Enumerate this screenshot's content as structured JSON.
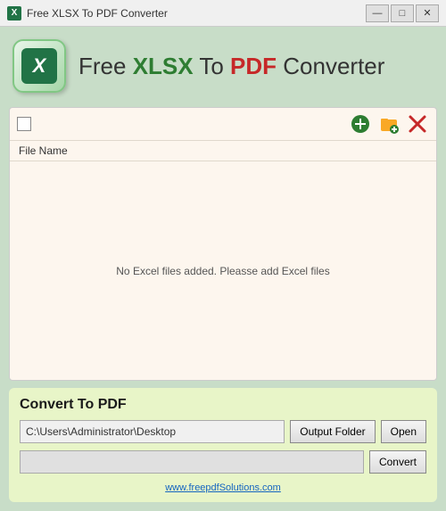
{
  "titleBar": {
    "icon": "X",
    "title": "Free XLSX To PDF Converter",
    "minimize": "—",
    "maximize": "□",
    "close": "✕"
  },
  "header": {
    "iconLetter": "X",
    "titlePart1": "Free ",
    "titlePart2": "XLSX",
    "titlePart3": " To ",
    "titlePart4": "PDF",
    "titlePart5": " Converter"
  },
  "fileArea": {
    "columnHeader": "File Name",
    "emptyMessage": "No Excel files added. Pleasse add Excel files"
  },
  "toolbar": {
    "addGreenTooltip": "Add files",
    "addYellowTooltip": "Add folder",
    "deleteTooltip": "Remove files"
  },
  "bottomSection": {
    "convertTitle": "Convert To PDF",
    "outputPath": "C:\\Users\\Administrator\\Desktop",
    "outputFolderLabel": "Output Folder",
    "openLabel": "Open",
    "convertLabel": "Convert",
    "progressValue": 0
  },
  "footer": {
    "link": "www.freepdfSolutions.com"
  }
}
